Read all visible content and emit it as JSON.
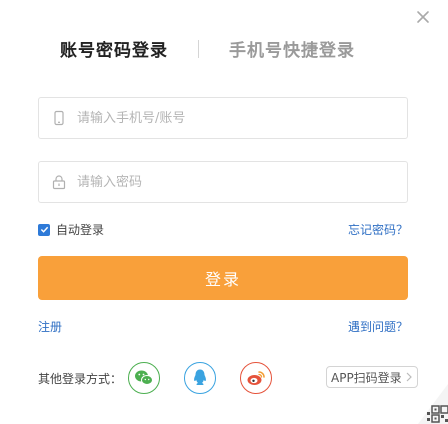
{
  "tabs": {
    "account": "账号密码登录",
    "phone": "手机号快捷登录"
  },
  "fields": {
    "account_placeholder": "请输入手机号/账号",
    "password_placeholder": "请输入密码"
  },
  "remember": {
    "label": "自动登录",
    "checked": true,
    "forgot": "忘记密码？"
  },
  "login_button": "登录",
  "links": {
    "register": "注册",
    "problem": "遇到问题？"
  },
  "other": {
    "label": "其他登录方式：",
    "providers": [
      "wechat-icon",
      "qq-icon",
      "weibo-icon"
    ],
    "app_scan": "APP扫码登录"
  },
  "colors": {
    "accent": "#f9a03a",
    "link": "#2f6fc4",
    "wechat": "#4caf50",
    "qq": "#3aa3e0",
    "weibo": "#e5533b"
  }
}
